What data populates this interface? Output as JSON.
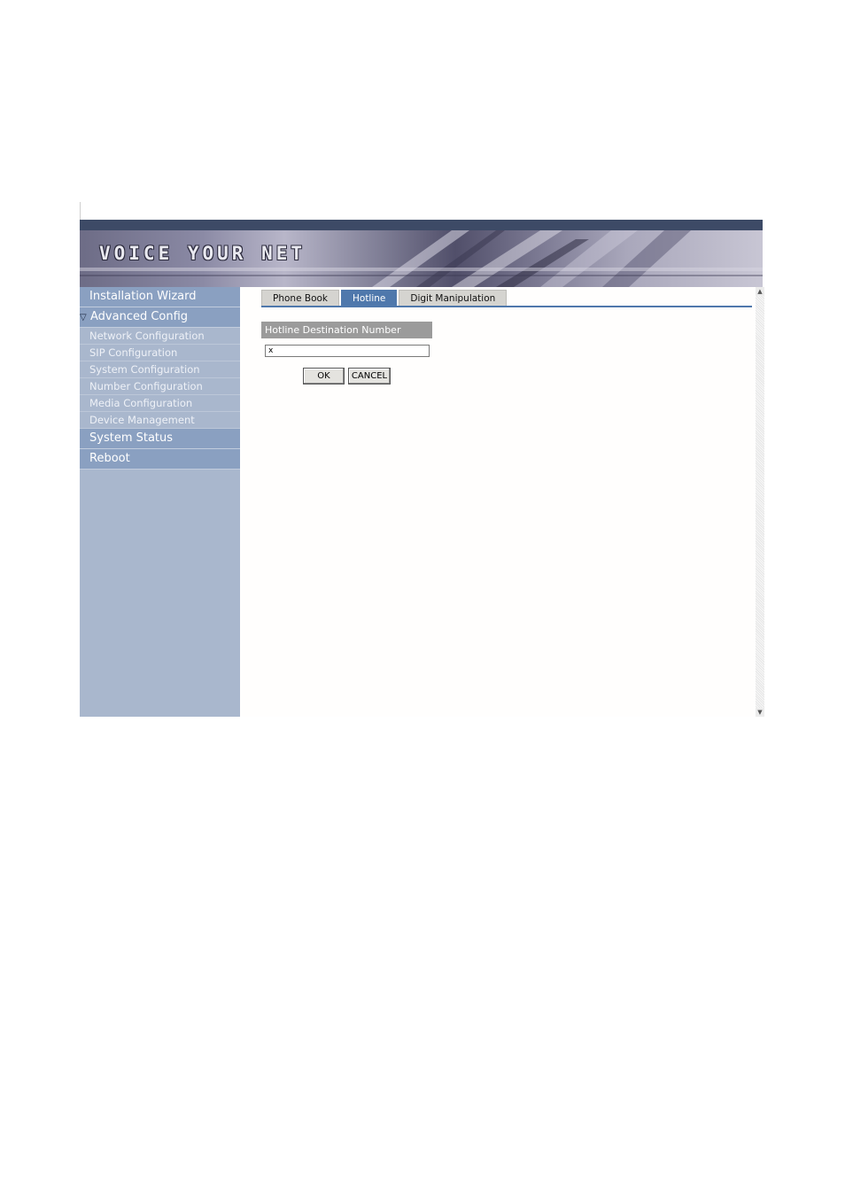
{
  "banner": {
    "title": "VOICE YOUR NET"
  },
  "sidebar": {
    "installation_wizard": "Installation Wizard",
    "advanced_config": {
      "label": "Advanced Config",
      "expand_icon": "triangle-down-icon"
    },
    "sub_items": [
      "Network Configuration",
      "SIP Configuration",
      "System Configuration",
      "Number Configuration",
      "Media Configuration",
      "Device Management"
    ],
    "system_status": "System Status",
    "reboot": "Reboot"
  },
  "tabs": [
    {
      "label": "Phone Book",
      "active": false
    },
    {
      "label": "Hotline",
      "active": true
    },
    {
      "label": "Digit Manipulation",
      "active": false
    }
  ],
  "form": {
    "field_label": "Hotline Destination Number",
    "field_value": "x",
    "ok_label": "OK",
    "cancel_label": "CANCEL"
  },
  "colors": {
    "sidebar_bg": "#a9b7cd",
    "sidebar_main": "#8aa0c1",
    "accent_blue": "#4f78ac",
    "label_gray": "#9b9b9b"
  }
}
